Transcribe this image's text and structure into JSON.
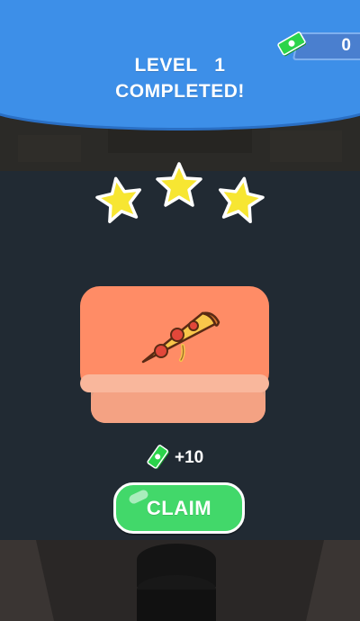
{
  "header": {
    "title_lines": [
      "LEVEL   1",
      "COMPLETED!"
    ]
  },
  "currency": {
    "balance": "0",
    "icon": "cash-icon"
  },
  "stars": {
    "earned": 3,
    "total": 3,
    "icon": "star-icon"
  },
  "reward_item": {
    "icon": "pizza-slice-icon"
  },
  "reward": {
    "amount_label": "+10",
    "icon": "cash-icon"
  },
  "claim_button": {
    "label": "CLAIM"
  },
  "colors": {
    "header": "#3d8fe8",
    "star": "#f7e632",
    "crate": "#ff8c66",
    "claim_button": "#42d86a",
    "cash": "#1fbf3a"
  }
}
